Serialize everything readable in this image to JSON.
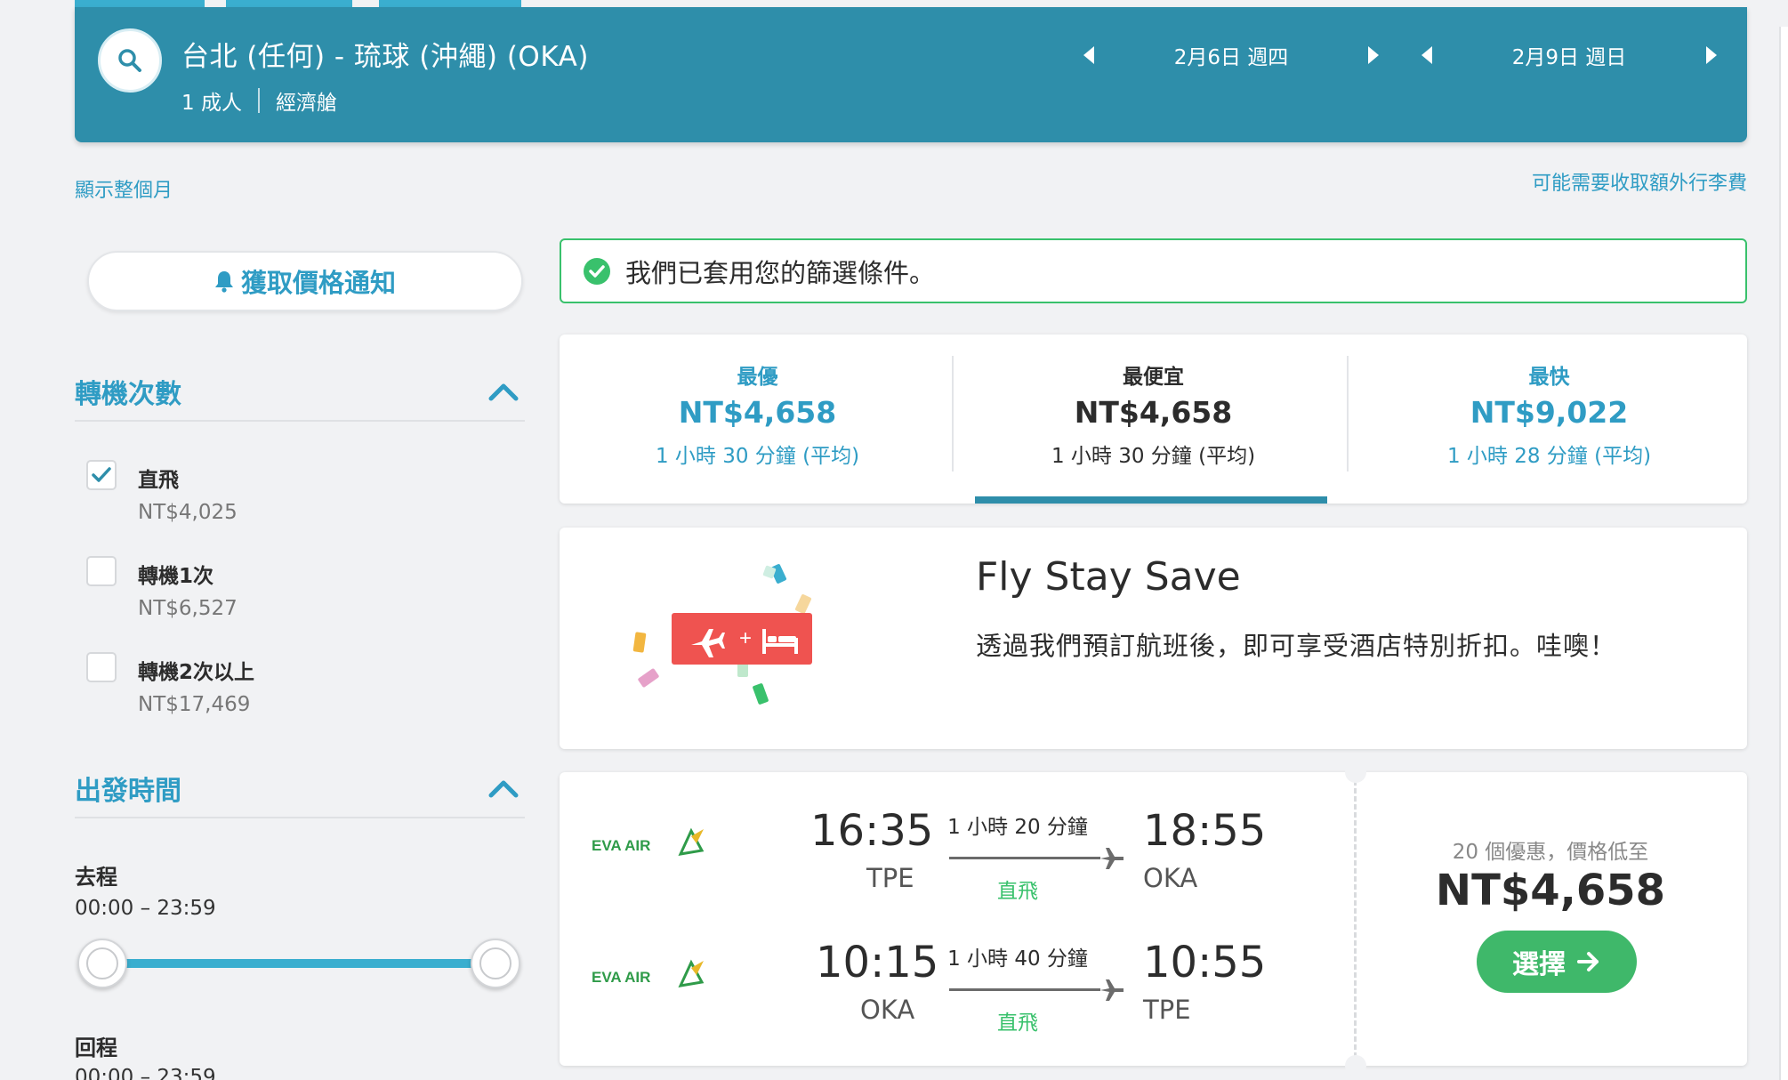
{
  "header": {
    "route": "台北 (任何) - 琉球 (沖繩) (OKA)",
    "passengers": "1 成人",
    "cabin": "經濟艙",
    "depart_date": "2月6日 週四",
    "return_date": "2月9日 週日"
  },
  "links": {
    "show_month": "顯示整個月",
    "baggage_fee": "可能需要收取額外行李費"
  },
  "sidebar": {
    "price_alert": "獲取價格通知",
    "stops": {
      "title": "轉機次數",
      "options": [
        {
          "label": "直飛",
          "price": "NT$4,025",
          "checked": true
        },
        {
          "label": "轉機1次",
          "price": "NT$6,527",
          "checked": false
        },
        {
          "label": "轉機2次以上",
          "price": "NT$17,469",
          "checked": false
        }
      ]
    },
    "departure_time": {
      "title": "出發時間",
      "outbound_label": "去程",
      "outbound_range": "00:00 – 23:59",
      "return_label": "回程",
      "return_range": "00:00 – 23:59"
    }
  },
  "filter_banner": "我們已套用您的篩選條件。",
  "sort": [
    {
      "label": "最優",
      "price": "NT$4,658",
      "duration": "1 小時 30 分鐘 (平均)",
      "selected": false
    },
    {
      "label": "最便宜",
      "price": "NT$4,658",
      "duration": "1 小時 30 分鐘 (平均)",
      "selected": true
    },
    {
      "label": "最快",
      "price": "NT$9,022",
      "duration": "1 小時 28 分鐘 (平均)",
      "selected": false
    }
  ],
  "promo": {
    "title": "Fly Stay Save",
    "text": "透過我們預訂航班後，即可享受酒店特別折扣。哇噢！",
    "plus": "+"
  },
  "flight": {
    "legs": [
      {
        "airline": "EVA AIR",
        "depart_time": "16:35",
        "depart_code": "TPE",
        "duration": "1 小時 20 分鐘",
        "stops": "直飛",
        "arrive_time": "18:55",
        "arrive_code": "OKA"
      },
      {
        "airline": "EVA AIR",
        "depart_time": "10:15",
        "depart_code": "OKA",
        "duration": "1 小時 40 分鐘",
        "stops": "直飛",
        "arrive_time": "10:55",
        "arrive_code": "TPE"
      }
    ],
    "deals": "20 個優惠，價格低至",
    "price": "NT$4,658",
    "select_label": "選擇"
  },
  "colors": {
    "brand_teal": "#2e8eaa",
    "link_blue": "#2f9cc4",
    "success_green": "#39c16c",
    "select_green": "#3fb86a",
    "eva_green": "#2f9b49"
  },
  "icons": [
    "search-icon",
    "prev-arrow-icon",
    "next-arrow-icon",
    "bell-icon",
    "chevron-up-icon",
    "check-icon",
    "check-circle-icon",
    "plane-icon",
    "bed-icon",
    "arrow-right-icon",
    "eva-air-logo"
  ]
}
